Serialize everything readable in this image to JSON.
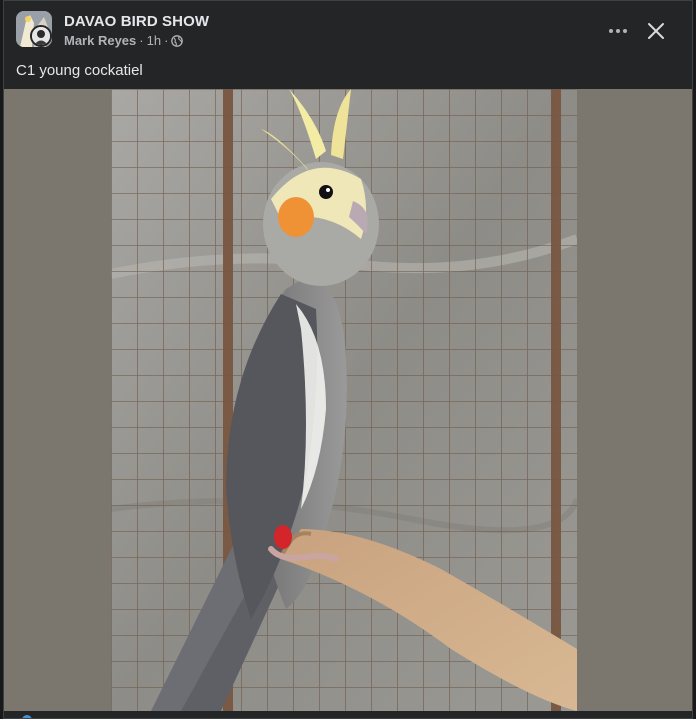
{
  "post": {
    "group_name": "DAVAO BIRD SHOW",
    "author": "Mark Reyes",
    "time": "1h",
    "separator": "·",
    "privacy_icon": "globe-icon",
    "caption": "C1 young cockatiel"
  },
  "header": {
    "more_icon": "more-horizontal-icon",
    "close_icon": "close-icon"
  },
  "colors": {
    "background": "#242526",
    "text_primary": "#e4e6eb",
    "text_secondary": "#b0b3b8",
    "photo_matte": "#7b776f"
  }
}
